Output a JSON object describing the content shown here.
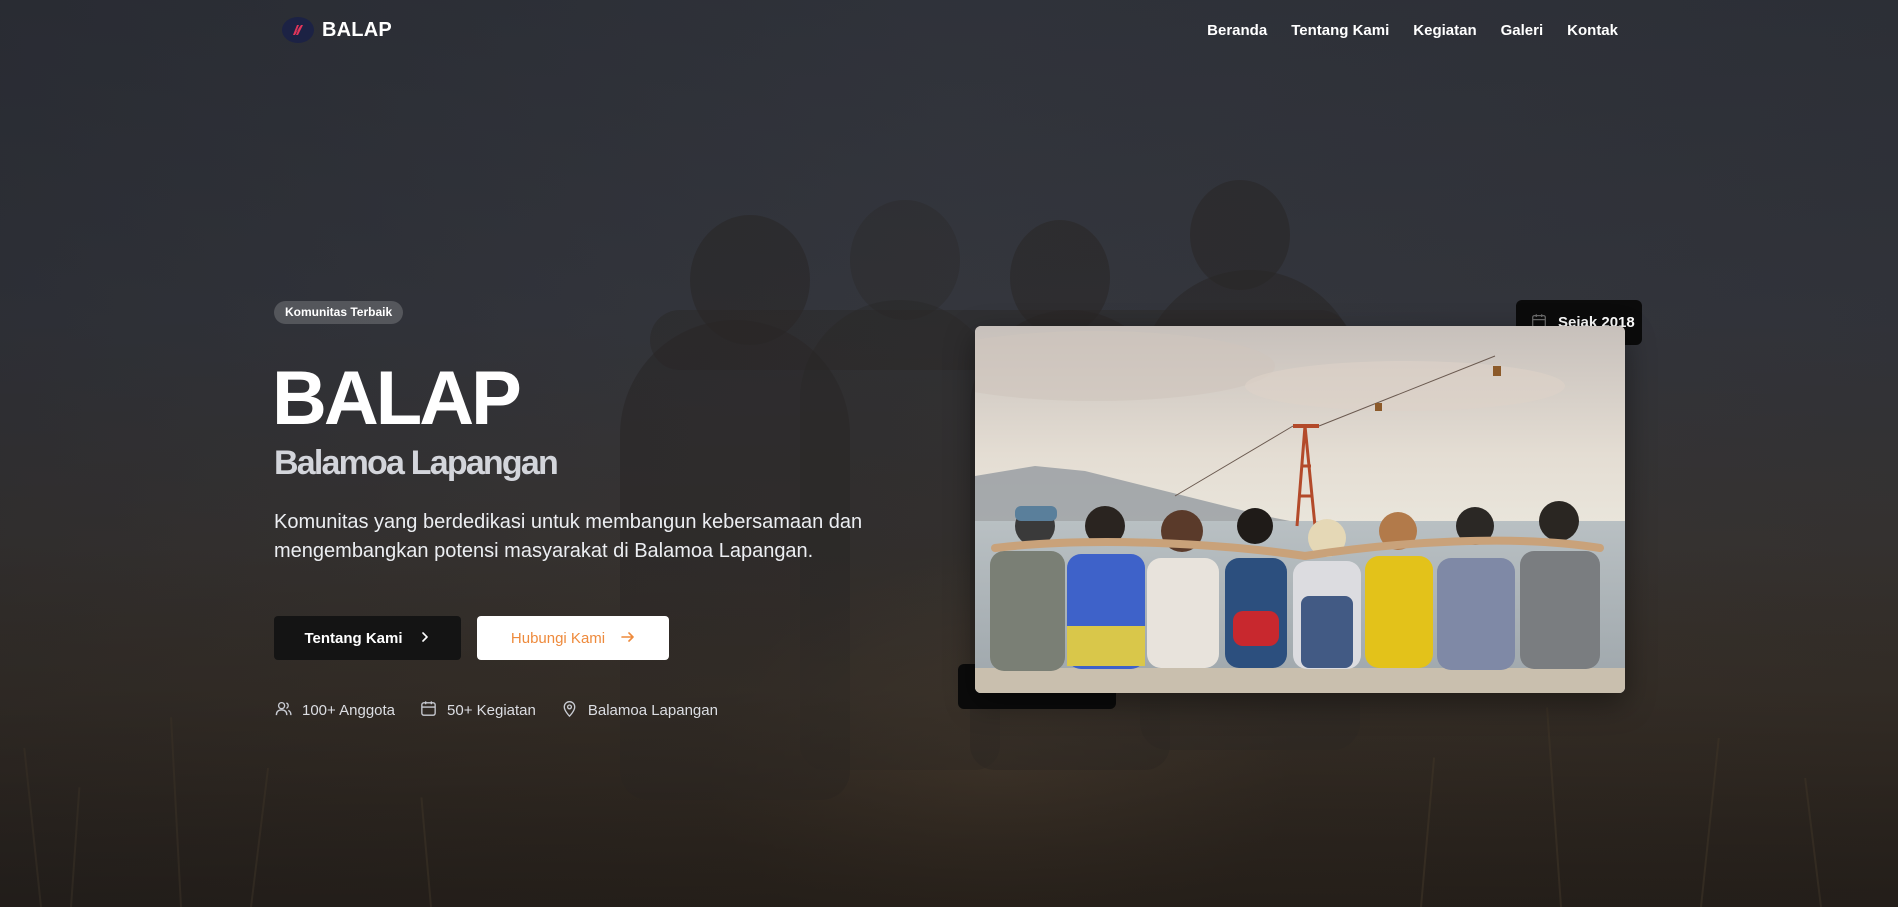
{
  "brand": {
    "name": "BALAP",
    "logo_icon": "community-logo-icon"
  },
  "nav": {
    "items": [
      {
        "label": "Beranda"
      },
      {
        "label": "Tentang Kami"
      },
      {
        "label": "Kegiatan"
      },
      {
        "label": "Galeri"
      },
      {
        "label": "Kontak"
      }
    ]
  },
  "hero": {
    "badge": "Komunitas Terbaik",
    "title": "BALAP",
    "subtitle": "Balamoa Lapangan",
    "description": "Komunitas yang berdedikasi untuk membangun kebersamaan dan mengembangkan potensi masyarakat di Balamoa Lapangan.",
    "primary_button": {
      "label": "Tentang Kami",
      "icon": "chevron-right-icon"
    },
    "secondary_button": {
      "label": "Hubungi Kami",
      "icon": "arrow-right-icon"
    },
    "stats": [
      {
        "icon": "users-icon",
        "label": "100+ Anggota"
      },
      {
        "icon": "calendar-icon",
        "label": "50+ Kegiatan"
      },
      {
        "icon": "map-pin-icon",
        "label": "Balamoa Lapangan"
      }
    ]
  },
  "image_card": {
    "since_badge": {
      "icon": "calendar-icon",
      "label": "Sejak 2018"
    }
  },
  "colors": {
    "accent_orange": "#ee8a3c",
    "button_dark": "#141414",
    "logo_bg": "#1c2244",
    "logo_mark": "#e0355a"
  }
}
